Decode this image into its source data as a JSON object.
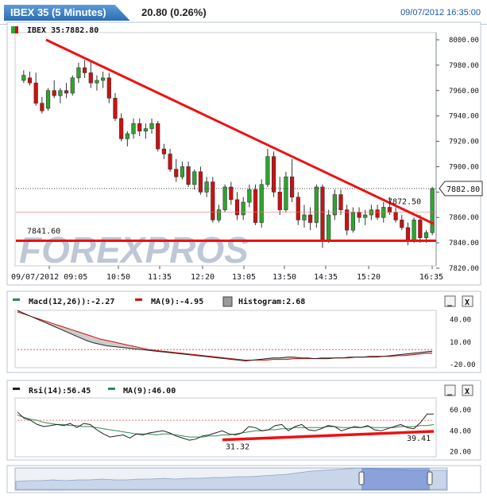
{
  "header": {
    "title": "IBEX 35 (5 Minutes)",
    "change": "20.80 (0.26%)",
    "datetime": "09/07/2012 16:35:00"
  },
  "main_legend": "IBEX 35:7882.80",
  "watermark": "FOREXPROS",
  "price_flag": "7882.80",
  "support_label": "7841.60",
  "trend_label": "7872.50",
  "macd": {
    "legend_macd": "Macd(12,26)):-2.27",
    "legend_ma": "MA(9):-4.95",
    "legend_hist": "Histogram:2.68",
    "ticks": [
      "40.00",
      "10.00",
      "-20.00"
    ]
  },
  "rsi": {
    "legend_rsi": "Rsi(14):56.45",
    "legend_ma": "MA(9):46.00",
    "ticks": [
      "60.00",
      "40.00",
      "20.00"
    ],
    "trend_start_label": "31.32",
    "trend_end_label": "39.41"
  },
  "buttons": {
    "minimize": "_",
    "close": "X"
  },
  "colors": {
    "up": "#2fa52f",
    "down": "#cc1111",
    "trend": "#ee1111",
    "macd": "#222222",
    "ma": "#cc1111",
    "rsi": "#222222",
    "rsi_ma": "#2e8b57"
  },
  "chart_data": {
    "type": "candlestick",
    "title": "IBEX 35 (5 Minutes)",
    "x_tick_labels": [
      "09/07/2012 09:05",
      "10:50",
      "11:35",
      "12:20",
      "13:05",
      "13:50",
      "14:35",
      "15:20",
      "16:35"
    ],
    "y_tick_labels": [
      "8000.00",
      "7980.00",
      "7960.00",
      "7940.00",
      "7920.00",
      "7900.00",
      "7880.00",
      "7860.00",
      "7840.00",
      "7820.00"
    ],
    "ylim": [
      7820,
      8000
    ],
    "last_price": 7882.8,
    "support_level": 7841.6,
    "trendline": {
      "start": 8000,
      "end": 7855
    },
    "candles": [
      {
        "o": 7968,
        "h": 7976,
        "l": 7966,
        "c": 7972
      },
      {
        "o": 7970,
        "h": 7975,
        "l": 7964,
        "c": 7966
      },
      {
        "o": 7966,
        "h": 7974,
        "l": 7948,
        "c": 7950
      },
      {
        "o": 7950,
        "h": 7955,
        "l": 7942,
        "c": 7944
      },
      {
        "o": 7946,
        "h": 7962,
        "l": 7944,
        "c": 7960
      },
      {
        "o": 7960,
        "h": 7968,
        "l": 7954,
        "c": 7956
      },
      {
        "o": 7956,
        "h": 7962,
        "l": 7950,
        "c": 7960
      },
      {
        "o": 7960,
        "h": 7966,
        "l": 7954,
        "c": 7958
      },
      {
        "o": 7958,
        "h": 7972,
        "l": 7956,
        "c": 7970
      },
      {
        "o": 7970,
        "h": 7982,
        "l": 7966,
        "c": 7978
      },
      {
        "o": 7978,
        "h": 7984,
        "l": 7970,
        "c": 7974
      },
      {
        "o": 7974,
        "h": 7984,
        "l": 7962,
        "c": 7966
      },
      {
        "o": 7966,
        "h": 7972,
        "l": 7960,
        "c": 7968
      },
      {
        "o": 7968,
        "h": 7975,
        "l": 7962,
        "c": 7970
      },
      {
        "o": 7970,
        "h": 7974,
        "l": 7950,
        "c": 7954
      },
      {
        "o": 7954,
        "h": 7958,
        "l": 7936,
        "c": 7938
      },
      {
        "o": 7938,
        "h": 7942,
        "l": 7920,
        "c": 7922
      },
      {
        "o": 7922,
        "h": 7928,
        "l": 7916,
        "c": 7926
      },
      {
        "o": 7926,
        "h": 7938,
        "l": 7922,
        "c": 7934
      },
      {
        "o": 7934,
        "h": 7938,
        "l": 7924,
        "c": 7928
      },
      {
        "o": 7928,
        "h": 7934,
        "l": 7922,
        "c": 7930
      },
      {
        "o": 7930,
        "h": 7938,
        "l": 7926,
        "c": 7934
      },
      {
        "o": 7934,
        "h": 7936,
        "l": 7912,
        "c": 7914
      },
      {
        "o": 7914,
        "h": 7918,
        "l": 7906,
        "c": 7910
      },
      {
        "o": 7910,
        "h": 7914,
        "l": 7896,
        "c": 7898
      },
      {
        "o": 7898,
        "h": 7906,
        "l": 7888,
        "c": 7892
      },
      {
        "o": 7892,
        "h": 7904,
        "l": 7890,
        "c": 7900
      },
      {
        "o": 7900,
        "h": 7904,
        "l": 7884,
        "c": 7886
      },
      {
        "o": 7886,
        "h": 7898,
        "l": 7882,
        "c": 7896
      },
      {
        "o": 7896,
        "h": 7900,
        "l": 7878,
        "c": 7880
      },
      {
        "o": 7880,
        "h": 7892,
        "l": 7876,
        "c": 7888
      },
      {
        "o": 7888,
        "h": 7892,
        "l": 7856,
        "c": 7858
      },
      {
        "o": 7858,
        "h": 7870,
        "l": 7856,
        "c": 7866
      },
      {
        "o": 7866,
        "h": 7886,
        "l": 7864,
        "c": 7884
      },
      {
        "o": 7884,
        "h": 7888,
        "l": 7870,
        "c": 7874
      },
      {
        "o": 7874,
        "h": 7880,
        "l": 7858,
        "c": 7862
      },
      {
        "o": 7862,
        "h": 7876,
        "l": 7858,
        "c": 7872
      },
      {
        "o": 7872,
        "h": 7886,
        "l": 7868,
        "c": 7882
      },
      {
        "o": 7882,
        "h": 7886,
        "l": 7854,
        "c": 7856
      },
      {
        "o": 7856,
        "h": 7890,
        "l": 7852,
        "c": 7886
      },
      {
        "o": 7886,
        "h": 7914,
        "l": 7884,
        "c": 7908
      },
      {
        "o": 7908,
        "h": 7912,
        "l": 7876,
        "c": 7880
      },
      {
        "o": 7880,
        "h": 7892,
        "l": 7862,
        "c": 7866
      },
      {
        "o": 7866,
        "h": 7896,
        "l": 7864,
        "c": 7892
      },
      {
        "o": 7892,
        "h": 7906,
        "l": 7872,
        "c": 7876
      },
      {
        "o": 7876,
        "h": 7880,
        "l": 7854,
        "c": 7858
      },
      {
        "o": 7858,
        "h": 7870,
        "l": 7852,
        "c": 7862
      },
      {
        "o": 7862,
        "h": 7868,
        "l": 7850,
        "c": 7856
      },
      {
        "o": 7856,
        "h": 7886,
        "l": 7852,
        "c": 7884
      },
      {
        "o": 7884,
        "h": 7886,
        "l": 7836,
        "c": 7842
      },
      {
        "o": 7842,
        "h": 7866,
        "l": 7840,
        "c": 7862
      },
      {
        "o": 7862,
        "h": 7882,
        "l": 7858,
        "c": 7878
      },
      {
        "o": 7878,
        "h": 7882,
        "l": 7862,
        "c": 7866
      },
      {
        "o": 7866,
        "h": 7870,
        "l": 7846,
        "c": 7850
      },
      {
        "o": 7850,
        "h": 7868,
        "l": 7848,
        "c": 7864
      },
      {
        "o": 7864,
        "h": 7868,
        "l": 7856,
        "c": 7860
      },
      {
        "o": 7860,
        "h": 7866,
        "l": 7854,
        "c": 7862
      },
      {
        "o": 7862,
        "h": 7870,
        "l": 7858,
        "c": 7866
      },
      {
        "o": 7866,
        "h": 7870,
        "l": 7858,
        "c": 7860
      },
      {
        "o": 7860,
        "h": 7872,
        "l": 7856,
        "c": 7868
      },
      {
        "o": 7868,
        "h": 7876,
        "l": 7862,
        "c": 7864
      },
      {
        "o": 7864,
        "h": 7868,
        "l": 7856,
        "c": 7858
      },
      {
        "o": 7858,
        "h": 7862,
        "l": 7850,
        "c": 7852
      },
      {
        "o": 7852,
        "h": 7856,
        "l": 7838,
        "c": 7842
      },
      {
        "o": 7842,
        "h": 7860,
        "l": 7840,
        "c": 7858
      },
      {
        "o": 7858,
        "h": 7862,
        "l": 7840,
        "c": 7844
      },
      {
        "o": 7844,
        "h": 7850,
        "l": 7840,
        "c": 7848
      },
      {
        "o": 7848,
        "h": 7884,
        "l": 7846,
        "c": 7882.8
      }
    ],
    "macd_ylim": [
      -24,
      50
    ],
    "macd_line": [
      52,
      48,
      44,
      40,
      36,
      32,
      28,
      24,
      20,
      16,
      12,
      9,
      7,
      5,
      4,
      3,
      2,
      1,
      0,
      -1,
      -2,
      -3,
      -4,
      -5,
      -6,
      -7,
      -8,
      -9,
      -10,
      -11,
      -12,
      -13,
      -14,
      -15,
      -14,
      -13,
      -12,
      -11,
      -11,
      -10,
      -10,
      -11,
      -11,
      -12,
      -12,
      -12,
      -11,
      -11,
      -10,
      -10,
      -10,
      -9,
      -9,
      -9,
      -8,
      -7,
      -6,
      -5,
      -4,
      -3,
      -2
    ],
    "ma_line": [
      50,
      47,
      44,
      41,
      38,
      35,
      32,
      29,
      26,
      23,
      20,
      17,
      14,
      12,
      10,
      8,
      6,
      4,
      2,
      0,
      -1,
      -2,
      -3,
      -4,
      -5,
      -6,
      -7,
      -8,
      -9,
      -10,
      -11,
      -12,
      -13,
      -14,
      -14,
      -14,
      -14,
      -13,
      -13,
      -13,
      -12,
      -12,
      -12,
      -12,
      -11,
      -11,
      -11,
      -11,
      -11,
      -10,
      -10,
      -10,
      -10,
      -9,
      -9,
      -8,
      -8,
      -7,
      -6,
      -5,
      -5
    ],
    "rsi_ylim": [
      15,
      70
    ],
    "rsi_line": [
      58,
      52,
      50,
      46,
      44,
      45,
      46,
      45,
      47,
      43,
      47,
      46,
      41,
      37,
      34,
      35,
      36,
      33,
      37,
      36,
      38,
      39,
      40,
      38,
      35,
      33,
      31,
      32,
      35,
      36,
      38,
      40,
      37,
      36,
      38,
      44,
      43,
      40,
      41,
      45,
      46,
      40,
      44,
      46,
      41,
      40,
      42,
      45,
      44,
      40,
      42,
      44,
      43,
      45,
      41,
      40,
      42,
      44,
      46,
      43,
      42,
      48,
      56,
      56
    ],
    "rsi_ma_line": [
      55,
      53,
      51,
      50,
      48,
      47,
      46,
      46,
      45,
      45,
      44,
      44,
      43,
      42,
      41,
      40,
      39,
      38,
      37,
      37,
      37,
      36,
      37,
      37,
      36,
      35,
      34,
      34,
      34,
      35,
      35,
      36,
      36,
      37,
      38,
      39,
      40,
      40,
      41,
      41,
      42,
      42,
      43,
      43,
      43,
      43,
      43,
      44,
      44,
      43,
      43,
      43,
      43,
      44,
      43,
      43,
      43,
      43,
      44,
      44,
      44,
      45,
      45,
      46
    ],
    "rsi_trend": {
      "start": 31.32,
      "end": 39.41
    }
  }
}
